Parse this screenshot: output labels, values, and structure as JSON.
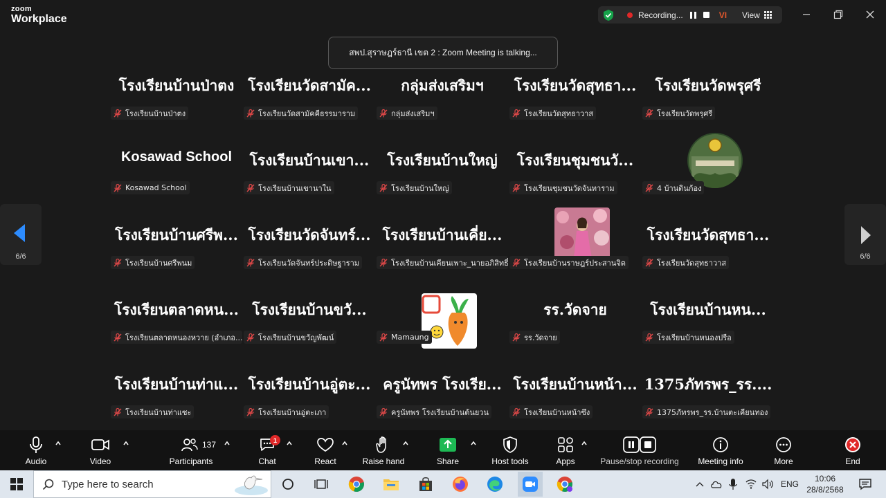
{
  "app": {
    "brand_top": "zoom",
    "brand_bottom": "Workplace"
  },
  "recording": {
    "text": "Recording...",
    "host_initials": "VI",
    "view_label": "View"
  },
  "toast": "สพป.สุราษฎร์ธานี เขต 2 : Zoom Meeting is talking...",
  "page_indicator": {
    "left": "6/6",
    "right": "6/6"
  },
  "tiles": [
    {
      "big": "โรงเรียนบ้านป่าตง",
      "name": "โรงเรียนบ้านป่าตง"
    },
    {
      "big": "โรงเรียนวัดสามัค...",
      "name": "โรงเรียนวัดสามัคคีธรรมาราม"
    },
    {
      "big": "กลุ่มส่งเสริมฯ",
      "name": "กลุ่มส่งเสริมฯ"
    },
    {
      "big": "โรงเรียนวัดสุทธา...",
      "name": "โรงเรียนวัดสุทธาวาส"
    },
    {
      "big": "โรงเรียนวัดพรุศรี",
      "name": "โรงเรียนวัดพรุศรี"
    },
    {
      "big": "Kosawad School",
      "name": "Kosawad School"
    },
    {
      "big": "โรงเรียนบ้านเขา...",
      "name": "โรงเรียนบ้านเขานาใน"
    },
    {
      "big": "โรงเรียนบ้านใหญ่",
      "name": "โรงเรียนบ้านใหญ่"
    },
    {
      "big": "โรงเรียนชุมชนวั...",
      "name": "โรงเรียนชุมชนวัดจันทาราม"
    },
    {
      "big": "",
      "name": "4 บ้านดินก้อง"
    },
    {
      "big": "โรงเรียนบ้านศรีพ...",
      "name": "โรงเรียนบ้านศรีพนม"
    },
    {
      "big": "โรงเรียนวัดจันทร์...",
      "name": "โรงเรียนวัดจันทร์ประดิษฐาราม"
    },
    {
      "big": "โรงเรียนบ้านเคี่ย...",
      "name": "โรงเรียนบ้านเคียนเพาะ_นายอภิสิทธิ์"
    },
    {
      "big": "",
      "name": "โรงเรียนบ้านราษฎร์ประสานจิต"
    },
    {
      "big": "โรงเรียนวัดสุทธา...",
      "name": "โรงเรียนวัดสุทธาวาส"
    },
    {
      "big": "โรงเรียนตลาดหน...",
      "name": "โรงเรียนตลาดหนองหวาย (อำเภอ..."
    },
    {
      "big": "โรงเรียนบ้านขวั...",
      "name": "โรงเรียนบ้านขวัญพัฒน์"
    },
    {
      "big": "",
      "name": "Mamaung"
    },
    {
      "big": "รร.วัดจาย",
      "name": "รร.วัดจาย"
    },
    {
      "big": "โรงเรียนบ้านหน...",
      "name": "โรงเรียนบ้านหนองปรือ"
    },
    {
      "big": "โรงเรียนบ้านท่าแ...",
      "name": "โรงเรียนบ้านท่าแซะ"
    },
    {
      "big": "โรงเรียนบ้านอู่ตะ...",
      "name": "โรงเรียนบ้านอู่ตะเภา"
    },
    {
      "big": "ครูนัทพร โรงเรีย...",
      "name": "ครูนัทพร โรงเรียนบ้านต้นยวน"
    },
    {
      "big": "โรงเรียนบ้านหน้า...",
      "name": "โรงเรียนบ้านหน้าซึง"
    },
    {
      "big": "1375ภัทรพร_รร....",
      "name": "1375ภัทรพร_รร.บ้านตะเคียนทอง"
    }
  ],
  "toolbar": {
    "audio": "Audio",
    "video": "Video",
    "participants": "Participants",
    "participants_count": "137",
    "chat": "Chat",
    "chat_badge": "1",
    "react": "React",
    "raise_hand": "Raise hand",
    "share": "Share",
    "host_tools": "Host tools",
    "apps": "Apps",
    "pause_stop": "Pause/stop recording",
    "meeting_info": "Meeting info",
    "more": "More",
    "end": "End"
  },
  "taskbar": {
    "search_placeholder": "Type here to search",
    "lang": "ENG",
    "time": "10:06",
    "date": "28/8/2568"
  },
  "colors": {
    "accent_green": "#0e9f3e",
    "end_red": "#e02828",
    "share_green": "#1db954"
  }
}
